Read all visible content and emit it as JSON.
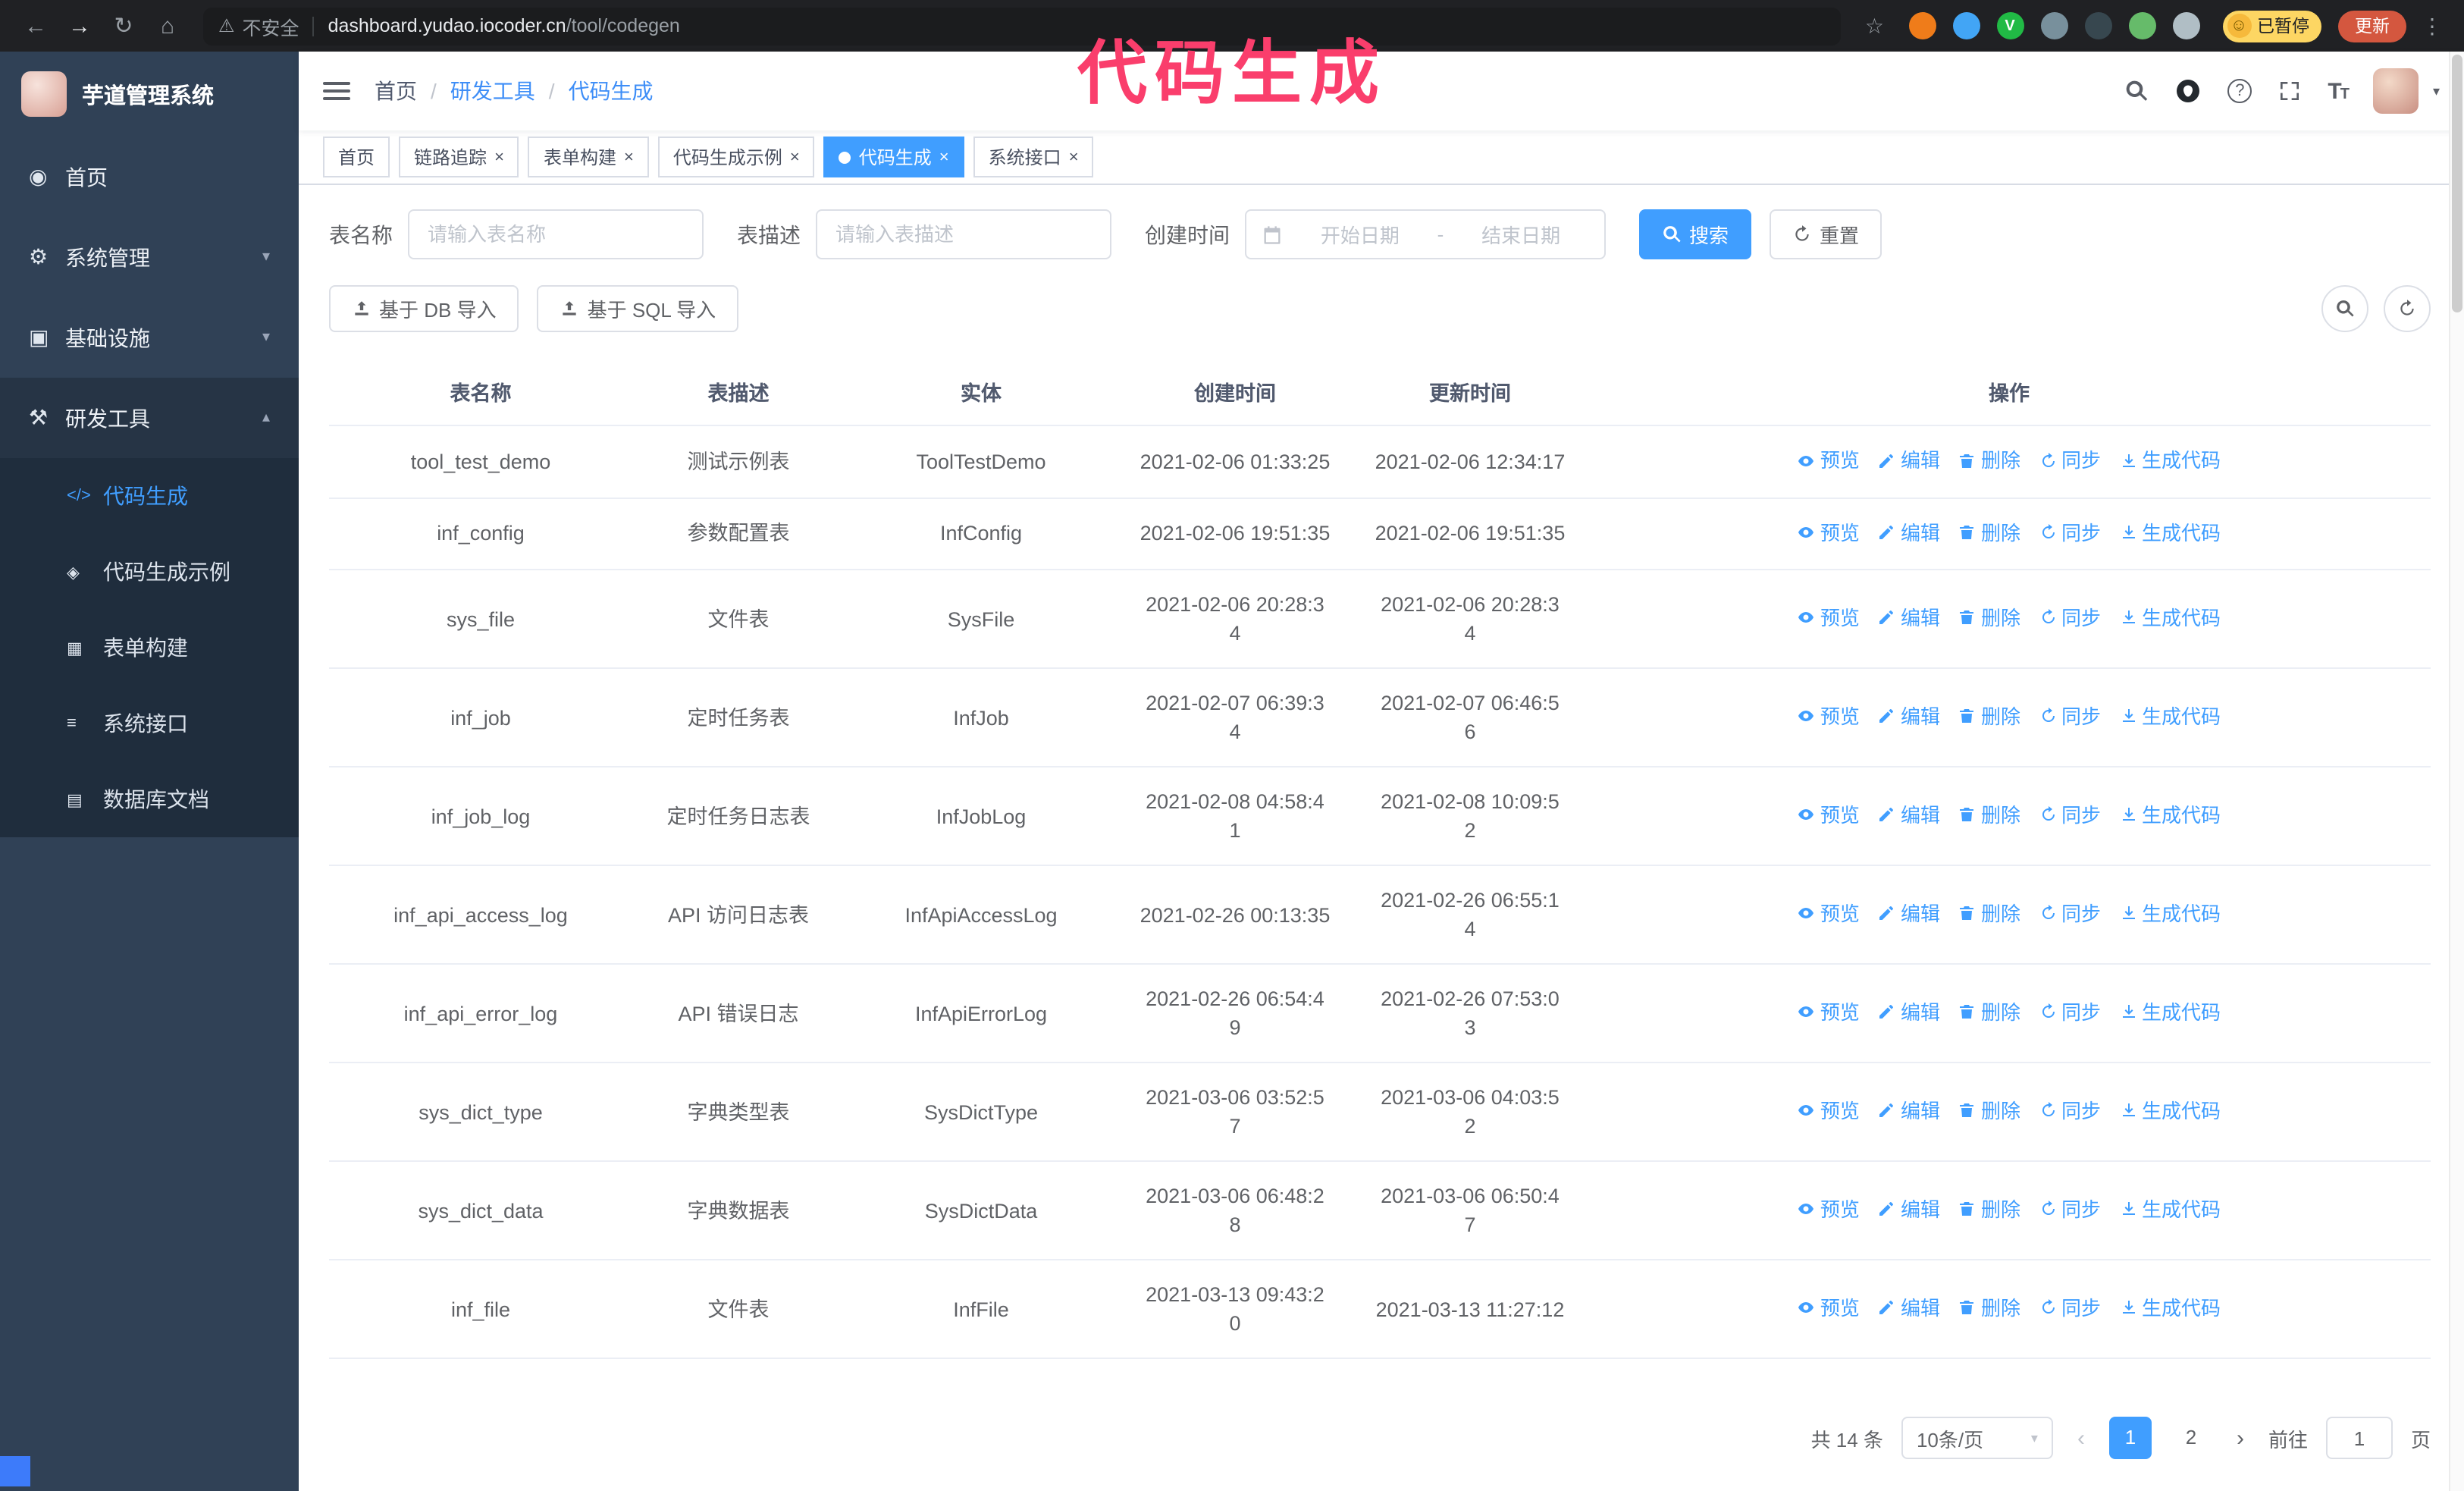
{
  "colors": {
    "accent": "#409eff",
    "sidebar_bg": "#304156",
    "annotation": "#fa3e6c"
  },
  "browser": {
    "security_label": "不安全",
    "url_host": "dashboard.yudao.iocoder.cn",
    "url_path": "/tool/codegen",
    "paused_badge": "已暂停",
    "update_button": "更新"
  },
  "annotation": {
    "text": "代码生成"
  },
  "sidebar": {
    "logo_title": "芋道管理系统",
    "items": [
      {
        "label": "首页"
      },
      {
        "label": "系统管理"
      },
      {
        "label": "基础设施"
      },
      {
        "label": "研发工具"
      }
    ],
    "sub_items": [
      {
        "label": "代码生成"
      },
      {
        "label": "代码生成示例"
      },
      {
        "label": "表单构建"
      },
      {
        "label": "系统接口"
      },
      {
        "label": "数据库文档"
      }
    ]
  },
  "header": {
    "breadcrumb": [
      "首页",
      "研发工具",
      "代码生成"
    ],
    "sep": "/"
  },
  "tabs": [
    {
      "label": "首页"
    },
    {
      "label": "链路追踪"
    },
    {
      "label": "表单构建"
    },
    {
      "label": "代码生成示例"
    },
    {
      "label": "代码生成"
    },
    {
      "label": "系统接口"
    }
  ],
  "filters": {
    "table_name_label": "表名称",
    "table_name_placeholder": "请输入表名称",
    "table_desc_label": "表描述",
    "table_desc_placeholder": "请输入表描述",
    "create_time_label": "创建时间",
    "date_start_placeholder": "开始日期",
    "date_sep": "-",
    "date_end_placeholder": "结束日期",
    "search_button": "搜索",
    "reset_button": "重置"
  },
  "toolbar": {
    "import_db": "基于 DB 导入",
    "import_sql": "基于 SQL 导入"
  },
  "table": {
    "columns": [
      "表名称",
      "表描述",
      "实体",
      "创建时间",
      "更新时间",
      "操作"
    ],
    "ops": [
      "预览",
      "编辑",
      "删除",
      "同步",
      "生成代码"
    ],
    "rows": [
      {
        "name": "tool_test_demo",
        "desc": "测试示例表",
        "entity": "ToolTestDemo",
        "created": "2021-02-06 01:33:25",
        "updated": "2021-02-06 12:34:17"
      },
      {
        "name": "inf_config",
        "desc": "参数配置表",
        "entity": "InfConfig",
        "created": "2021-02-06 19:51:35",
        "updated": "2021-02-06 19:51:35"
      },
      {
        "name": "sys_file",
        "desc": "文件表",
        "entity": "SysFile",
        "created": "2021-02-06 20:28:3\n4",
        "updated": "2021-02-06 20:28:3\n4"
      },
      {
        "name": "inf_job",
        "desc": "定时任务表",
        "entity": "InfJob",
        "created": "2021-02-07 06:39:3\n4",
        "updated": "2021-02-07 06:46:5\n6"
      },
      {
        "name": "inf_job_log",
        "desc": "定时任务日志表",
        "entity": "InfJobLog",
        "created": "2021-02-08 04:58:4\n1",
        "updated": "2021-02-08 10:09:5\n2"
      },
      {
        "name": "inf_api_access_log",
        "desc": "API 访问日志表",
        "entity": "InfApiAccessLog",
        "created": "2021-02-26 00:13:35",
        "updated": "2021-02-26 06:55:1\n4"
      },
      {
        "name": "inf_api_error_log",
        "desc": "API 错误日志",
        "entity": "InfApiErrorLog",
        "created": "2021-02-26 06:54:4\n9",
        "updated": "2021-02-26 07:53:0\n3"
      },
      {
        "name": "sys_dict_type",
        "desc": "字典类型表",
        "entity": "SysDictType",
        "created": "2021-03-06 03:52:5\n7",
        "updated": "2021-03-06 04:03:5\n2"
      },
      {
        "name": "sys_dict_data",
        "desc": "字典数据表",
        "entity": "SysDictData",
        "created": "2021-03-06 06:48:2\n8",
        "updated": "2021-03-06 06:50:4\n7"
      },
      {
        "name": "inf_file",
        "desc": "文件表",
        "entity": "InfFile",
        "created": "2021-03-13 09:43:2\n0",
        "updated": "2021-03-13 11:27:12"
      }
    ]
  },
  "pagination": {
    "total": "共 14 条",
    "page_size": "10条/页",
    "pages": [
      "1",
      "2"
    ],
    "goto_label": "前往",
    "goto_value": "1",
    "goto_suffix": "页"
  }
}
